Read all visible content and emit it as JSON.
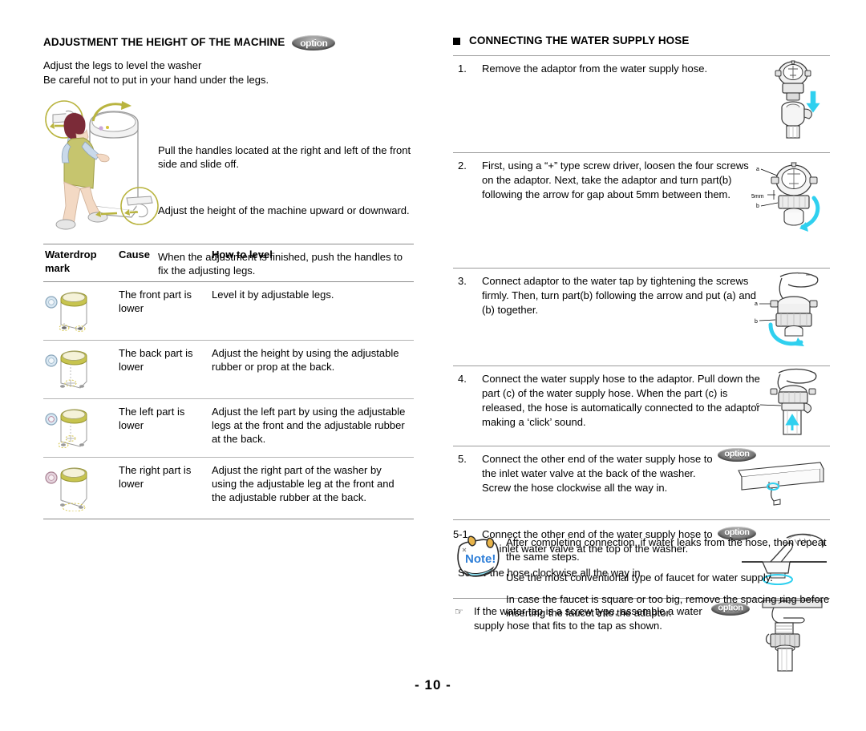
{
  "left": {
    "section_title": "ADJUSTMENT THE HEIGHT OF THE MACHINE",
    "option_badge_label": "option",
    "intro_line1": "Adjust the legs to level the washer",
    "intro_line2": "Be careful not to put in your hand under the legs.",
    "illustration_name": "woman-adjusting-washer-legs",
    "steps": [
      "Pull the handles located at the right and left of the front side and slide off.",
      "Adjust the height of the machine upward or downward.",
      "When the adjustment is finished, push the handles to fix the adjusting legs."
    ],
    "table": {
      "headers": [
        "Waterdrop mark",
        "Cause",
        "How to level"
      ],
      "rows": [
        {
          "icon": "washer-front-low-icon",
          "cause": "The front part is lower",
          "how": "Level it by adjustable legs."
        },
        {
          "icon": "washer-back-low-icon",
          "cause": "The back part is lower",
          "how": "Adjust the height by using the adjustable rubber or prop at the back."
        },
        {
          "icon": "washer-left-low-icon",
          "cause": "The left part is lower",
          "how": "Adjust the left part by using the adjustable legs at the front and the adjustable rubber at the back."
        },
        {
          "icon": "washer-right-low-icon",
          "cause": "The right part is lower",
          "how": "Adjust the right part of the washer by using the adjustable leg at the front and the adjustable rubber at the back."
        }
      ]
    }
  },
  "right": {
    "section_title": "CONNECTING THE WATER SUPPLY HOSE",
    "option_badge_label": "option",
    "steps": [
      {
        "num": "1.",
        "text": "Remove the adaptor from the water supply hose.",
        "art": "adaptor-separating-diagram",
        "has_option": false
      },
      {
        "num": "2.",
        "text": "First, using a “+” type screw driver, loosen the four screws on the adaptor. Next, take the adaptor and turn part(b) following the arrow for gap about 5mm between them.",
        "art": "adaptor-loosen-screws-diagram",
        "has_option": false,
        "art_labels": [
          "a",
          "5mm",
          "b"
        ]
      },
      {
        "num": "3.",
        "text": "Connect adaptor to the water tap by tightening the screws firmly. Then, turn part(b) following the arrow and put (a) and (b) together.",
        "art": "adaptor-on-tap-diagram",
        "has_option": false,
        "art_labels": [
          "a",
          "b"
        ]
      },
      {
        "num": "4.",
        "text": "Connect the water supply hose to the adaptor. Pull down the part (c) of the water supply hose. When the part (c) is released, the hose is automatically connected to the adaptor making a ‘click’ sound.",
        "art": "hose-click-connect-diagram",
        "has_option": false,
        "art_labels": [
          "c"
        ]
      },
      {
        "num": "5.",
        "text": "Connect the other end of the water supply hose to the inlet water valve at the back of the washer. Screw the hose clockwise all the way in.",
        "art": "washer-back-inlet-valve-diagram",
        "has_option": true
      },
      {
        "num": "5-1.",
        "text": "Connect the other end of the water supply hose to the inlet water valve at the top of the washer.",
        "extra_line": "Screw the hose clockwise all the way in.",
        "art": "washer-top-inlet-valve-diagram",
        "has_option": true
      },
      {
        "num": "☞",
        "text": "If the water tap is a screw type, assemble a water supply hose that fits to the tap as shown.",
        "art": "screw-type-tap-diagram",
        "has_option": true
      }
    ]
  },
  "note": {
    "icon_label": "Note!",
    "icon_name": "note-scroll-icon",
    "lines": [
      "After completing connection, if water leaks from the hose, then repeat the same steps.",
      "Use the most conventional type of faucet for water supply.",
      "In case the faucet is square or too big, remove the spacing ring before inserting the faucet into the adaptor."
    ]
  },
  "footer": {
    "page_number": "- 10 -"
  },
  "colors": {
    "rule_strong": "#8b8b8b",
    "rule_light": "#b4b4b4",
    "illustration_olive": "#b9b43f",
    "illustration_hair": "#7b2b38",
    "note_blue": "#3a7fd5",
    "arrow_cyan": "#1fc8e8"
  }
}
